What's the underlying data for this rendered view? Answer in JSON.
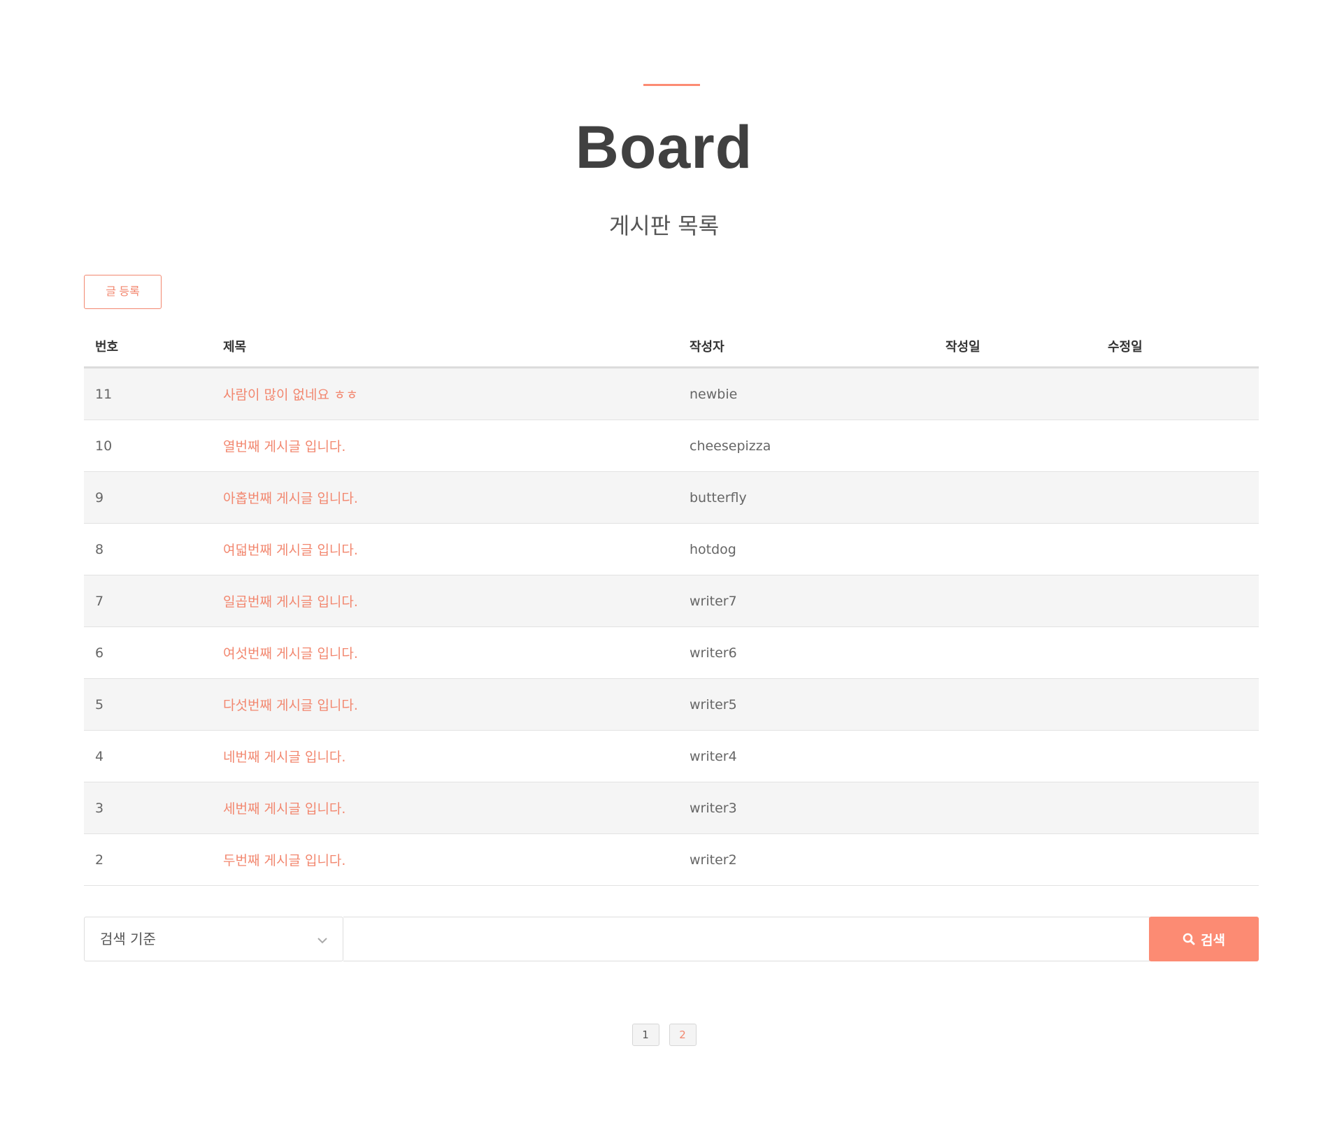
{
  "header": {
    "title": "Board",
    "subtitle": "게시판 목록"
  },
  "actions": {
    "register_label": "글 등록"
  },
  "table": {
    "columns": [
      "번호",
      "제목",
      "작성자",
      "작성일",
      "수정일"
    ],
    "rows": [
      {
        "num": "11",
        "title": "사람이 많이 없네요 ㅎㅎ",
        "writer": "newbie",
        "created": "",
        "updated": ""
      },
      {
        "num": "10",
        "title": "열번째 게시글 입니다.",
        "writer": "cheesepizza",
        "created": "",
        "updated": ""
      },
      {
        "num": "9",
        "title": "아홉번째 게시글 입니다.",
        "writer": "butterfly",
        "created": "",
        "updated": ""
      },
      {
        "num": "8",
        "title": "여덟번째 게시글 입니다.",
        "writer": "hotdog",
        "created": "",
        "updated": ""
      },
      {
        "num": "7",
        "title": "일곱번째 게시글 입니다.",
        "writer": "writer7",
        "created": "",
        "updated": ""
      },
      {
        "num": "6",
        "title": "여섯번째 게시글 입니다.",
        "writer": "writer6",
        "created": "",
        "updated": ""
      },
      {
        "num": "5",
        "title": "다섯번째 게시글 입니다.",
        "writer": "writer5",
        "created": "",
        "updated": ""
      },
      {
        "num": "4",
        "title": "네번째 게시글 입니다.",
        "writer": "writer4",
        "created": "",
        "updated": ""
      },
      {
        "num": "3",
        "title": "세번째 게시글 입니다.",
        "writer": "writer3",
        "created": "",
        "updated": ""
      },
      {
        "num": "2",
        "title": "두번째 게시글 입니다.",
        "writer": "writer2",
        "created": "",
        "updated": ""
      }
    ]
  },
  "search": {
    "select_label": "검색 기준",
    "input_value": "",
    "button_label": "검색",
    "button_icon": "search-icon",
    "select_icon": "chevron-down-icon"
  },
  "pagination": {
    "pages": [
      "1",
      "2"
    ],
    "current": "2"
  },
  "colors": {
    "accent": "#fc8b73",
    "link": "#f2876f",
    "title_text": "#404040",
    "row_stripe": "#f5f5f5"
  }
}
